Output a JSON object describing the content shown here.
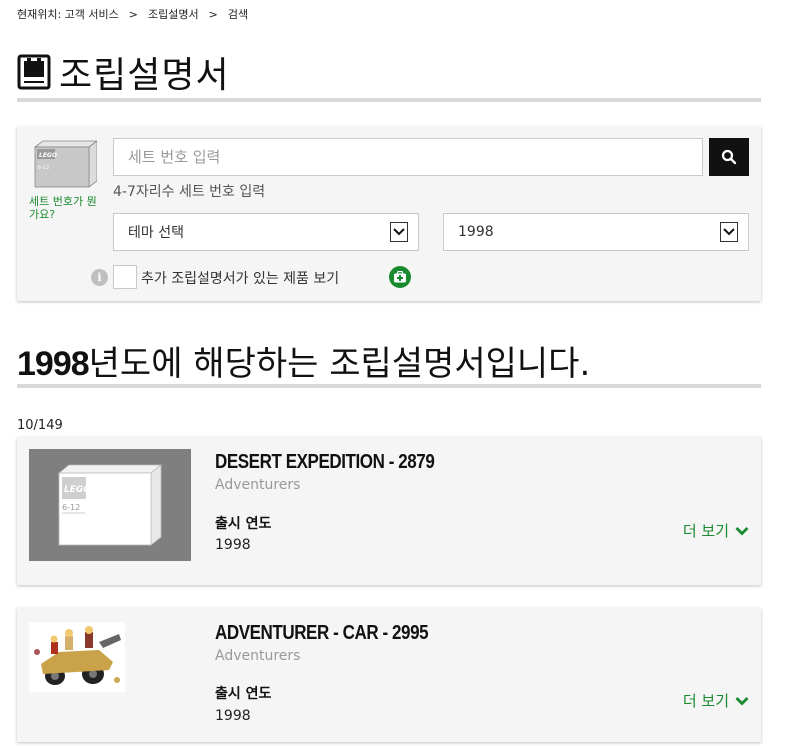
{
  "breadcrumb": {
    "prefix": "현재위치: 고객 서비스",
    "middle": "조립설명서",
    "current": "검색",
    "separator": ">"
  },
  "page": {
    "title": "조립설명서"
  },
  "search": {
    "placeholder": "세트 번호 입력",
    "value": "",
    "hint": "4-7자리수 세트 번호 입력",
    "help_link": "세트 번호가 뭔가요?",
    "theme_select": "테마 선택",
    "year_select": "1998",
    "checkbox_label": "추가 조립설명서가 있는 제품 보기",
    "checkbox_checked": false
  },
  "results": {
    "year": "1998",
    "heading_suffix": "년도에 해당하는 조립설명서입니다.",
    "count": "10/149",
    "items": [
      {
        "name": "DESERT EXPEDITION - 2879",
        "theme": "Adventurers",
        "release_label": "출시 연도",
        "release_year": "1998",
        "more": "더 보기"
      },
      {
        "name": "ADVENTURER - CAR - 2995",
        "theme": "Adventurers",
        "release_label": "출시 연도",
        "release_year": "1998",
        "more": "더 보기"
      }
    ]
  },
  "box_logo": {
    "brand": "LEGO",
    "age": "6-12"
  },
  "colors": {
    "accent_green": "#1a8a2e",
    "panel_bg": "#f5f5f5",
    "rule": "#d9d9d9",
    "dark": "#111111"
  }
}
